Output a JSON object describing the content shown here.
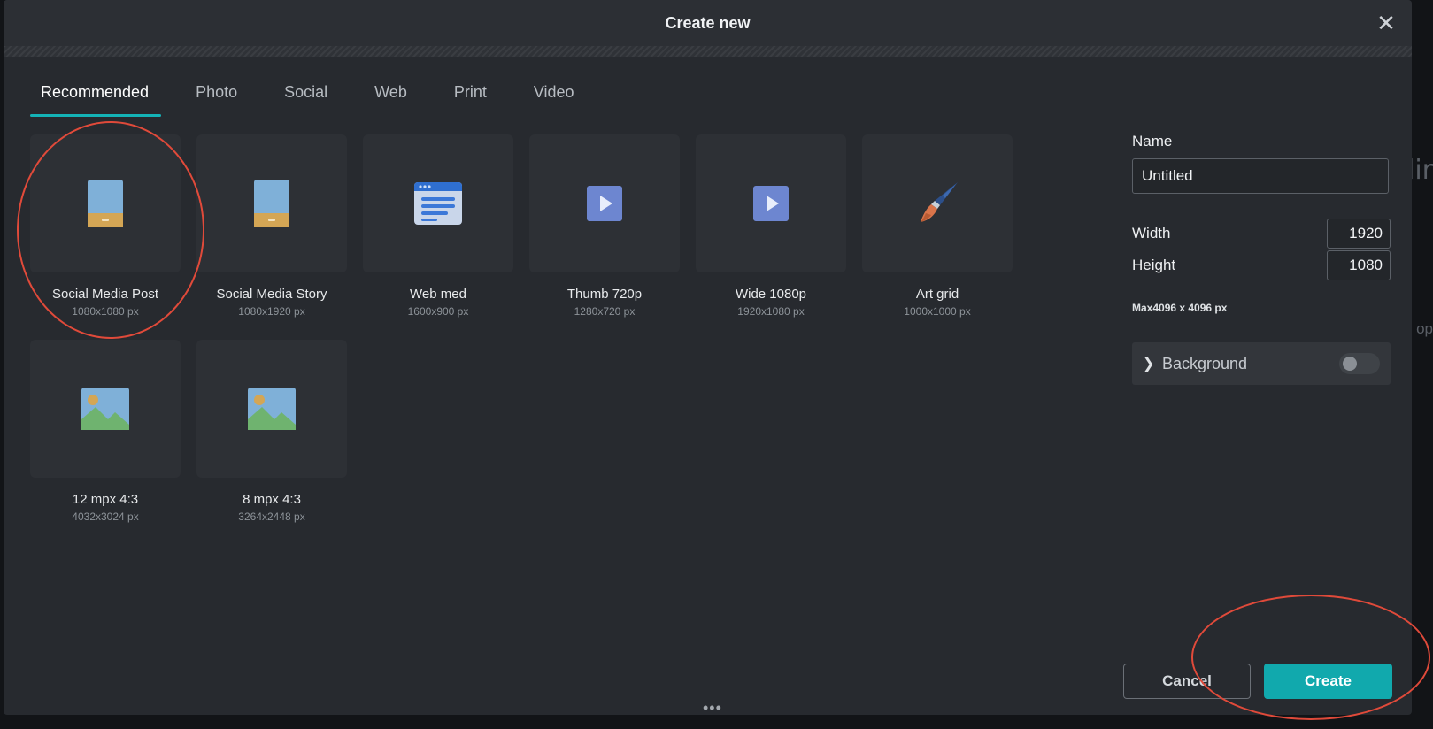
{
  "dialog": {
    "title": "Create new",
    "close_glyph": "✕"
  },
  "tabs": [
    {
      "label": "Recommended",
      "active": true
    },
    {
      "label": "Photo",
      "active": false
    },
    {
      "label": "Social",
      "active": false
    },
    {
      "label": "Web",
      "active": false
    },
    {
      "label": "Print",
      "active": false
    },
    {
      "label": "Video",
      "active": false
    }
  ],
  "presets": [
    {
      "name": "Social Media Post",
      "size": "1080x1080 px",
      "icon": "portrait-icon"
    },
    {
      "name": "Social Media Story",
      "size": "1080x1920 px",
      "icon": "portrait-icon"
    },
    {
      "name": "Web med",
      "size": "1600x900 px",
      "icon": "web-page-icon"
    },
    {
      "name": "Thumb 720p",
      "size": "1280x720 px",
      "icon": "video-play-icon"
    },
    {
      "name": "Wide 1080p",
      "size": "1920x1080 px",
      "icon": "video-play-icon"
    },
    {
      "name": "Art grid",
      "size": "1000x1000 px",
      "icon": "paintbrush-icon"
    },
    {
      "name": "12 mpx 4:3",
      "size": "4032x3024 px",
      "icon": "landscape-image-icon"
    },
    {
      "name": "8 mpx 4:3",
      "size": "3264x2448 px",
      "icon": "landscape-image-icon"
    }
  ],
  "panel": {
    "name_label": "Name",
    "name_value": "Untitled",
    "width_label": "Width",
    "width_value": "1920",
    "height_label": "Height",
    "height_value": "1080",
    "max_note": "Max4096 x 4096 px",
    "background_label": "Background",
    "background_enabled": false
  },
  "buttons": {
    "cancel": "Cancel",
    "create": "Create"
  },
  "footer_handle": "•••",
  "background_peek": {
    "text1": "lir",
    "text2": "e op"
  },
  "colors": {
    "accent": "#14b3b7",
    "create_button": "#11a9ad",
    "annotation": "#e04a3a"
  }
}
